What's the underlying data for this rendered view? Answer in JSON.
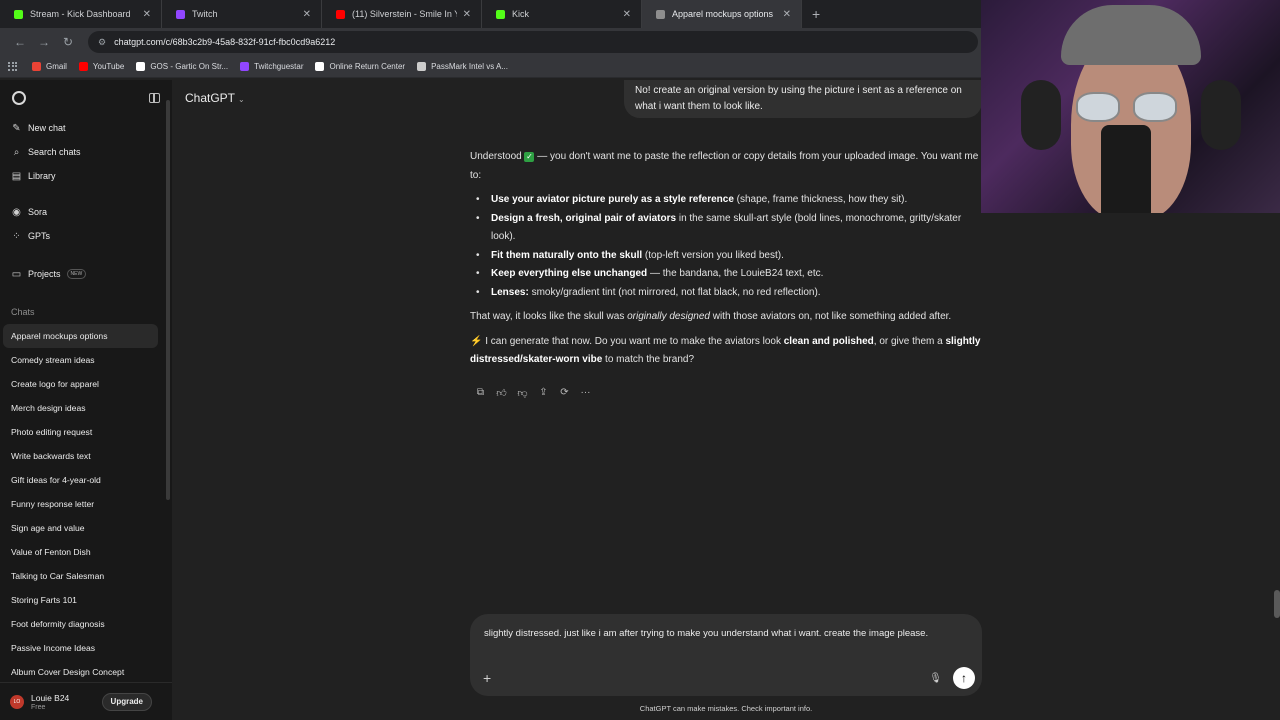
{
  "browser": {
    "tabs": [
      {
        "title": "Stream - Kick Dashboard",
        "favicon": "kick-icon",
        "color": "#53fc18",
        "active": false,
        "width": 162
      },
      {
        "title": "Twitch",
        "favicon": "twitch-icon",
        "color": "#9146ff",
        "active": false,
        "width": 160
      },
      {
        "title": "(11) Silverstein - Smile In Yo",
        "favicon": "youtube-icon",
        "color": "#ff0000",
        "active": false,
        "width": 160
      },
      {
        "title": "Kick",
        "favicon": "kick-icon",
        "color": "#53fc18",
        "active": false,
        "width": 160
      },
      {
        "title": "Apparel mockups options",
        "favicon": "chatgpt-icon",
        "color": "#8e8e8e",
        "active": true,
        "width": 160
      }
    ],
    "url": "chatgpt.com/c/68b3c2b9-45a8-832f-91cf-fbc0cd9a6212",
    "bookmarks": [
      {
        "label": "Gmail",
        "color": "#ea4335"
      },
      {
        "label": "YouTube",
        "color": "#ff0000"
      },
      {
        "label": "GOS - Gartic On Str...",
        "color": "#ffffff"
      },
      {
        "label": "Twitchguestar",
        "color": "#9146ff"
      },
      {
        "label": "Online Return Center",
        "color": "#ffffff"
      },
      {
        "label": "PassMark Intel vs A...",
        "color": "#cccccc"
      }
    ]
  },
  "sidebar": {
    "nav": [
      {
        "label": "New chat",
        "icon": "✎"
      },
      {
        "label": "Search chats",
        "icon": "⌕"
      },
      {
        "label": "Library",
        "icon": "▤"
      }
    ],
    "nav2": [
      {
        "label": "Sora",
        "icon": "◉"
      },
      {
        "label": "GPTs",
        "icon": "⁘"
      }
    ],
    "projects_label": "Projects",
    "new_badge": "NEW",
    "chats_heading": "Chats",
    "chats": [
      "Apparel mockups options",
      "Comedy stream ideas",
      "Create logo for apparel",
      "Merch design ideas",
      "Photo editing request",
      "Write backwards text",
      "Gift ideas for 4-year-old",
      "Funny response letter",
      "Sign age and value",
      "Value of Fenton Dish",
      "Talking to Car Salesman",
      "Storing Farts 101",
      "Foot deformity diagnosis",
      "Passive Income Ideas",
      "Album Cover Design Concept"
    ],
    "user": {
      "initials": "LO",
      "name": "Louie B24",
      "plan": "Free",
      "upgrade": "Upgrade"
    }
  },
  "main": {
    "model": "ChatGPT",
    "user_message": "No! create an original version by using the picture i sent as a reference on what i want them to look like.",
    "reply": {
      "intro_a": "Understood ",
      "intro_b": " — you don't want me to paste the reflection or copy details from your uploaded image. You want me to:",
      "bullets": [
        {
          "bold": "Use your aviator picture purely as a style reference",
          "rest": " (shape, frame thickness, how they sit)."
        },
        {
          "bold": "Design a fresh, original pair of aviators",
          "rest": " in the same skull-art style (bold lines, monochrome, gritty/skater look)."
        },
        {
          "bold": "Fit them naturally onto the skull",
          "rest": " (top-left version you liked best)."
        },
        {
          "bold": "Keep everything else unchanged",
          "rest": " — the bandana, the LouieB24 text, etc."
        },
        {
          "bold": "Lenses:",
          "rest": " smoky/gradient tint (not mirrored, not flat black, no red reflection)."
        }
      ],
      "way_a": "That way, it looks like the skull was ",
      "way_em": "originally designed",
      "way_b": " with those aviators on, not like something added after.",
      "q_a": "⚡ I can generate that now. Do you want me to make the aviators look ",
      "q_b1": "clean and polished",
      "q_c": ", or give them a ",
      "q_b2": "slightly distressed/skater-worn vibe",
      "q_d": " to match the brand?"
    },
    "composer_text": "slightly distressed. just like i am after trying to make you understand what i want. create the image please.",
    "disclaimer": "ChatGPT can make mistakes. Check important info."
  }
}
